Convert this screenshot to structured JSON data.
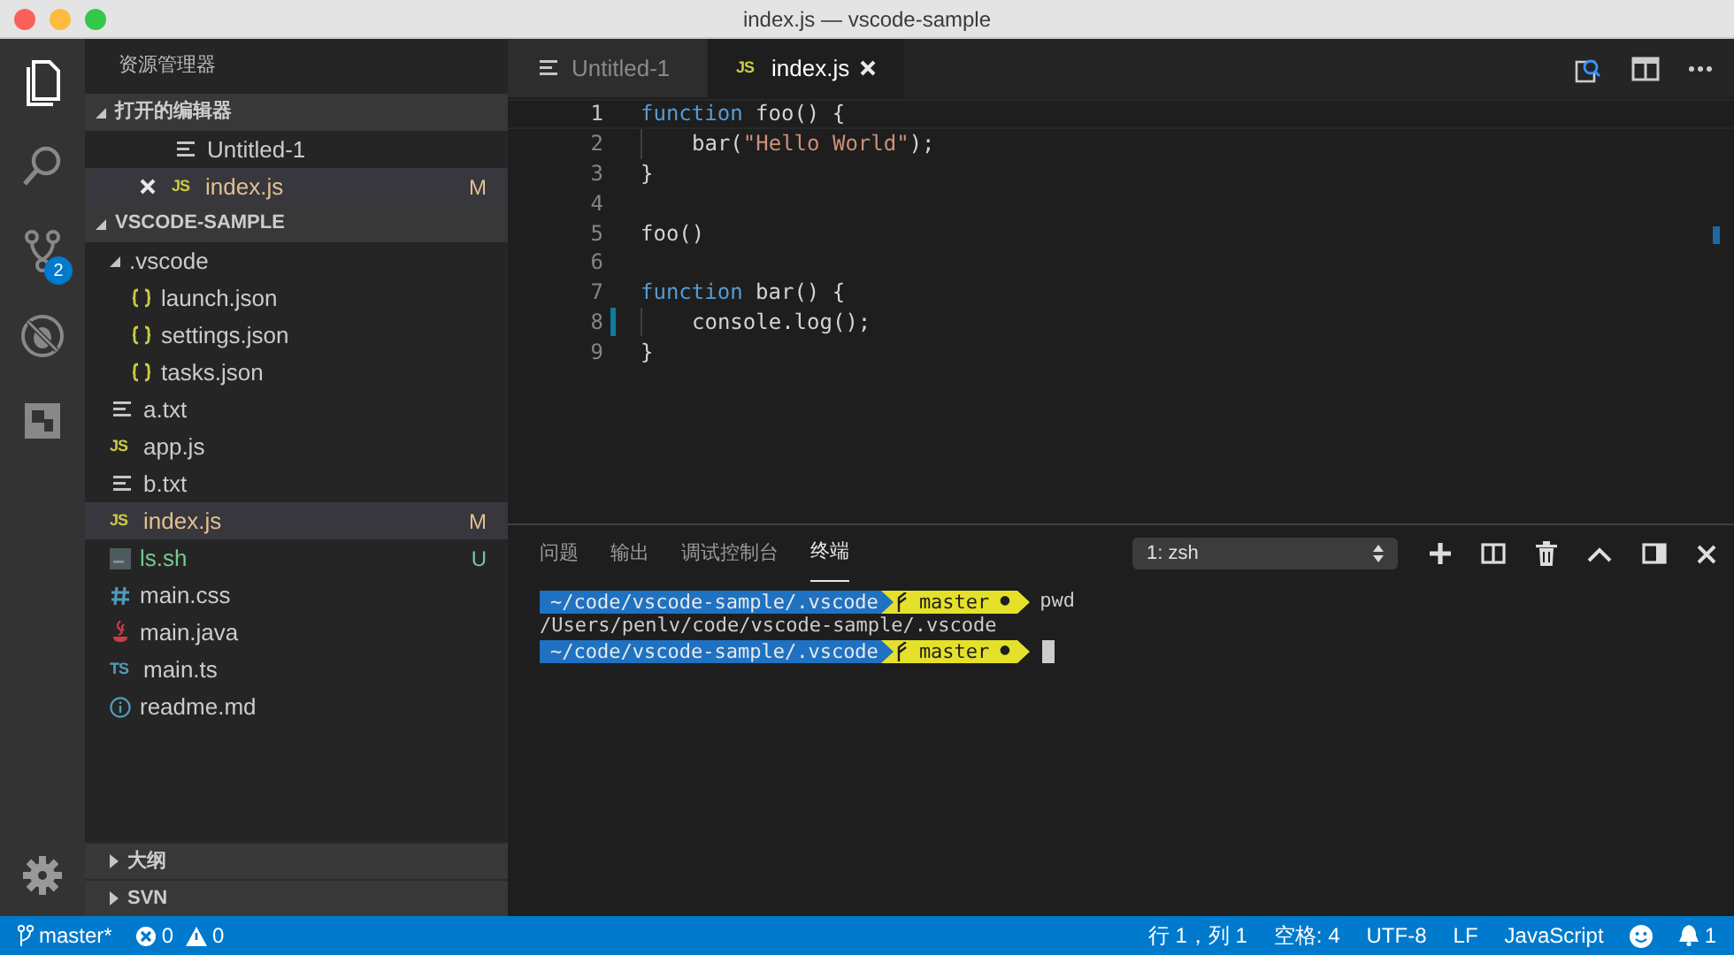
{
  "window": {
    "title": "index.js — vscode-sample"
  },
  "activity_bar": {
    "items": [
      {
        "selected": true
      },
      {
        "selected": false
      },
      {
        "selected": false,
        "badge": "2"
      },
      {
        "selected": false
      },
      {
        "selected": false
      }
    ]
  },
  "sidebar": {
    "title": "资源管理器",
    "open_editors": {
      "title": "打开的编辑器",
      "expanded": true,
      "items": [
        {
          "kind": "txt",
          "name": "Untitled-1",
          "selected": false,
          "close": false
        },
        {
          "kind": "js",
          "icon_label": "JS",
          "name": "index.js",
          "status": "M",
          "selected": true,
          "close": true
        }
      ]
    },
    "folder": {
      "title": "VSCODE-SAMPLE",
      "expanded": true,
      "items": [
        {
          "kind": "folder",
          "name": ".vscode",
          "expanded": true,
          "selected": false,
          "children": [
            {
              "kind": "json",
              "name": "launch.json",
              "selected": false
            },
            {
              "kind": "json",
              "name": "settings.json",
              "selected": false
            },
            {
              "kind": "json",
              "name": "tasks.json",
              "selected": false
            }
          ]
        },
        {
          "kind": "txt",
          "name": "a.txt",
          "selected": false
        },
        {
          "kind": "js",
          "icon_label": "JS",
          "name": "app.js",
          "selected": false
        },
        {
          "kind": "txt",
          "name": "b.txt",
          "selected": false
        },
        {
          "kind": "js",
          "icon_label": "JS",
          "name": "index.js",
          "status": "M",
          "selected": true
        },
        {
          "kind": "sh",
          "name": "ls.sh",
          "status": "U",
          "selected": false
        },
        {
          "kind": "css",
          "name": "main.css",
          "selected": false
        },
        {
          "kind": "java",
          "name": "main.java",
          "selected": false
        },
        {
          "kind": "ts",
          "icon_label": "TS",
          "name": "main.ts",
          "selected": false
        },
        {
          "kind": "info",
          "name": "readme.md",
          "selected": false
        }
      ]
    },
    "collapsed_sections": [
      {
        "title": "大纲",
        "expanded": false
      },
      {
        "title": "SVN",
        "expanded": false
      }
    ]
  },
  "editor": {
    "tabs": [
      {
        "kind": "txt",
        "label": "Untitled-1",
        "selected": false
      },
      {
        "kind": "js",
        "icon_label": "JS",
        "label": "index.js",
        "selected": true
      }
    ],
    "lines": [
      {
        "number": "1",
        "current": true,
        "indented": false,
        "modified": false,
        "tokens": [
          {
            "kind": "keyword",
            "text": "function"
          },
          {
            "kind": "plain",
            "text": " foo() {"
          }
        ]
      },
      {
        "number": "2",
        "current": false,
        "indented": true,
        "modified": false,
        "tokens": [
          {
            "kind": "plain",
            "text": "bar("
          },
          {
            "kind": "string",
            "text": "\"Hello World\""
          },
          {
            "kind": "plain",
            "text": ");"
          }
        ]
      },
      {
        "number": "3",
        "current": false,
        "indented": false,
        "modified": false,
        "tokens": [
          {
            "kind": "plain",
            "text": "}"
          }
        ]
      },
      {
        "number": "4",
        "current": false,
        "indented": false,
        "modified": false
      },
      {
        "number": "5",
        "current": false,
        "indented": false,
        "modified": false,
        "tokens": [
          {
            "kind": "plain",
            "text": "foo()"
          }
        ]
      },
      {
        "number": "6",
        "current": false,
        "indented": false,
        "modified": false
      },
      {
        "number": "7",
        "current": false,
        "indented": false,
        "modified": false,
        "tokens": [
          {
            "kind": "keyword",
            "text": "function"
          },
          {
            "kind": "plain",
            "text": " bar() {"
          }
        ]
      },
      {
        "number": "8",
        "current": false,
        "indented": true,
        "modified": true,
        "tokens": [
          {
            "kind": "plain",
            "text": "console.log();"
          }
        ]
      },
      {
        "number": "9",
        "current": false,
        "indented": false,
        "modified": false,
        "tokens": [
          {
            "kind": "plain",
            "text": "}"
          }
        ]
      }
    ]
  },
  "panel": {
    "tabs": [
      {
        "label": "问题",
        "selected": false
      },
      {
        "label": "输出",
        "selected": false
      },
      {
        "label": "调试控制台",
        "selected": false
      },
      {
        "label": "终端",
        "selected": true
      }
    ],
    "terminal_select": "1: zsh",
    "terminal": [
      {
        "kind": "prompt",
        "path": "~/code/vscode-sample/.vscode",
        "branch": "master",
        "dirty": "●",
        "command": "pwd",
        "cursor": false
      },
      {
        "kind": "output",
        "text": "/Users/penlv/code/vscode-sample/.vscode"
      },
      {
        "kind": "prompt",
        "path": "~/code/vscode-sample/.vscode",
        "branch": "master",
        "dirty": "●",
        "cursor": true
      }
    ]
  },
  "status_bar": {
    "branch": "master*",
    "errors": "0",
    "warnings": "0",
    "position": "行 1，列 1",
    "indent": "空格: 4",
    "encoding": "UTF-8",
    "eol": "LF",
    "language": "JavaScript",
    "notifications": "1"
  }
}
